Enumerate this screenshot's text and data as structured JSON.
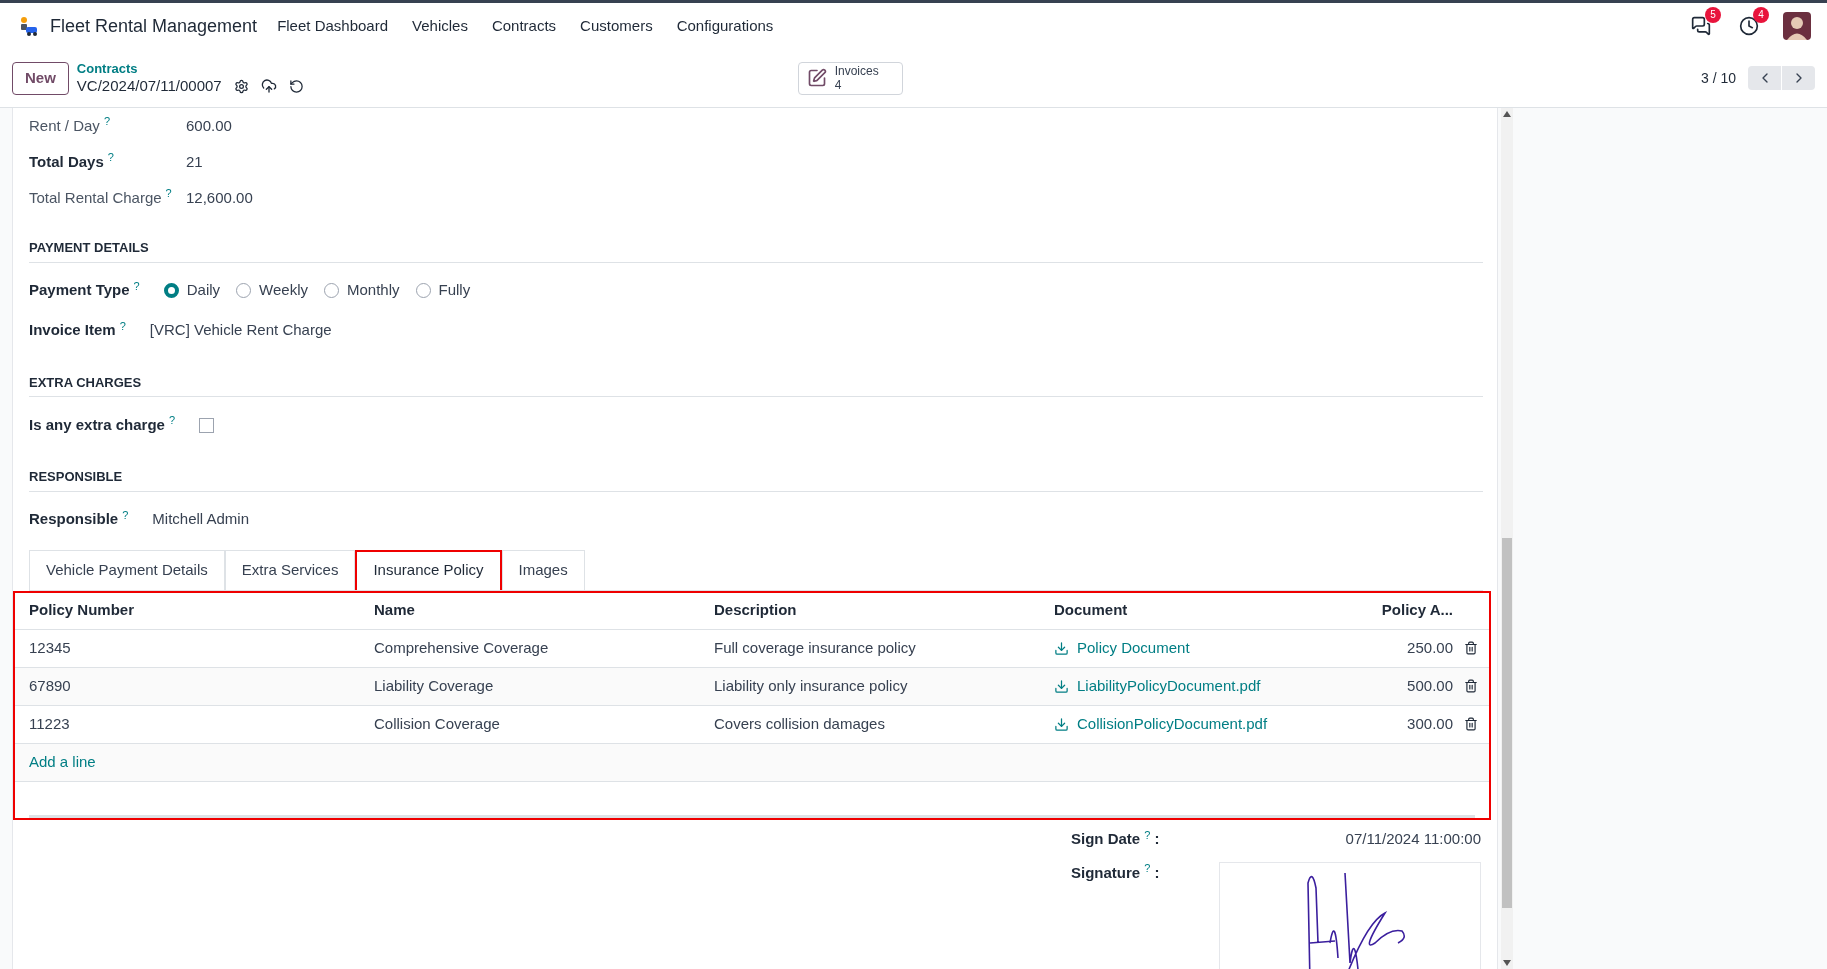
{
  "app": {
    "name": "Fleet Rental Management"
  },
  "menu": [
    "Fleet Dashboard",
    "Vehicles",
    "Contracts",
    "Customers",
    "Configurations"
  ],
  "systray": [
    {
      "kind": "chat",
      "badge": "5"
    },
    {
      "kind": "activity",
      "badge": "4"
    }
  ],
  "control": {
    "new_button": "New",
    "breadcrumb": "Contracts",
    "record": "VC/2024/07/11/00007",
    "smart_button": {
      "label": "Invoices",
      "count": "4"
    },
    "pager": "3 / 10"
  },
  "top_fields": [
    {
      "label": "Rent / Day",
      "help": "?",
      "value": "600.00",
      "bold": false
    },
    {
      "label": "Total Days",
      "help": "?",
      "value": "21",
      "bold": true
    },
    {
      "label": "Total Rental Charge",
      "help": "?",
      "value": "12,600.00",
      "bold": false
    }
  ],
  "sections": [
    {
      "title": "PAYMENT DETAILS",
      "fields": [
        {
          "kind": "radio",
          "label": "Payment Type",
          "help": "?",
          "options": [
            {
              "label": "Daily",
              "selected": true
            },
            {
              "label": "Weekly",
              "selected": false
            },
            {
              "label": "Monthly",
              "selected": false
            },
            {
              "label": "Fully",
              "selected": false
            }
          ]
        },
        {
          "kind": "text",
          "label": "Invoice Item",
          "help": "?",
          "value": "[VRC] Vehicle Rent Charge"
        }
      ]
    },
    {
      "title": "EXTRA CHARGES",
      "fields": [
        {
          "kind": "checkbox",
          "label": "Is any extra charge",
          "help": "?",
          "checked": false
        }
      ]
    },
    {
      "title": "RESPONSIBLE",
      "fields": [
        {
          "kind": "text",
          "label": "Responsible",
          "help": "?",
          "value": "Mitchell Admin"
        }
      ]
    }
  ],
  "tabs": [
    {
      "label": "Vehicle Payment Details",
      "selected": false,
      "highlighted": false
    },
    {
      "label": "Extra Services",
      "selected": false,
      "highlighted": false
    },
    {
      "label": "Insurance Policy",
      "selected": true,
      "highlighted": true
    },
    {
      "label": "Images",
      "selected": false,
      "highlighted": false
    }
  ],
  "table": {
    "highlighted": true,
    "columns": [
      "Policy Number",
      "Name",
      "Description",
      "Document",
      "Policy A..."
    ],
    "rows": [
      {
        "policy_number": "12345",
        "name": "Comprehensive Coverage",
        "description": "Full coverage insurance policy",
        "document": "Policy Document",
        "amount": "250.00"
      },
      {
        "policy_number": "67890",
        "name": "Liability Coverage",
        "description": "Liability only insurance policy",
        "document": "LiabilityPolicyDocument.pdf",
        "amount": "500.00"
      },
      {
        "policy_number": "11223",
        "name": "Collision Coverage",
        "description": "Covers collision damages",
        "document": "CollisionPolicyDocument.pdf",
        "amount": "300.00"
      }
    ],
    "add_line": "Add a line"
  },
  "sign": {
    "date_label": "Sign Date",
    "date_help": "?",
    "date_colon": ":",
    "date_value": "07/11/2024 11:00:00",
    "signature_label": "Signature",
    "signature_help": "?",
    "signature_colon": ":"
  }
}
